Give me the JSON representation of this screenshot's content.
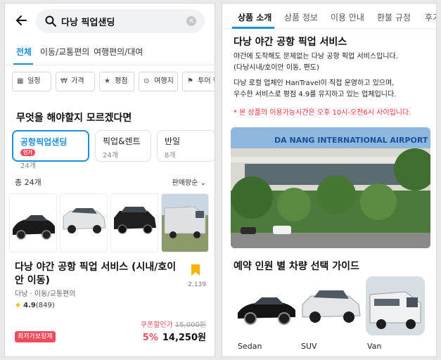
{
  "left": {
    "search": {
      "query": "다낭 픽업샌딩"
    },
    "tabs": [
      {
        "label": "전체"
      },
      {
        "label": "이동/교통편의"
      },
      {
        "label": "여행편의/대여"
      }
    ],
    "filters": [
      {
        "icon": "calendar-icon",
        "label": "일정"
      },
      {
        "icon": "won-icon",
        "label": "가격"
      },
      {
        "icon": "star-icon",
        "label": "평점"
      },
      {
        "icon": "location-pin-icon",
        "label": "여행지"
      },
      {
        "icon": "flag-icon",
        "label": "투어 형태"
      }
    ],
    "section_question": "무엇을 해야할지 모르겠다면",
    "categories": [
      {
        "name": "공항픽업샌딩",
        "badge": "인기",
        "count": "24개"
      },
      {
        "name": "픽업&렌트",
        "count": "24개"
      },
      {
        "name": "반일",
        "count": "8개"
      }
    ],
    "total": "총 24개",
    "sort": "판매량순",
    "product": {
      "title": "다낭 야간 공항 픽업 서비스 (시내/호이안 이동)",
      "category": "다낭 · 이동/교통편의",
      "rating": "4.9",
      "reviews": "(849)",
      "bookmarks": "2,139",
      "coupon_label": "쿠폰할인가",
      "original_price": "15,000원",
      "tag": "최저가보장제",
      "discount": "5%",
      "price": "14,250원"
    },
    "colors": {
      "accent": "#1b8fe0",
      "sale": "#ef4b5c",
      "bookmark": "#f5b400"
    }
  },
  "right": {
    "tabs": [
      {
        "label": "상품 소개"
      },
      {
        "label": "상품 정보"
      },
      {
        "label": "이용 안내"
      },
      {
        "label": "환불 규정"
      },
      {
        "label": "후기"
      }
    ],
    "heading": "다낭 야간 공항 픽업 서비스",
    "para1_line1": "야간에 도착해도 문제없는 다낭 공항 픽업 서비스입니다.",
    "para1_line2": "(다낭시내/호이안 이동, 편도)",
    "para2_line1": "다낭 로컬 업체인 HanTravel이 직접 운영하고 있으며,",
    "para2_line2": "우수한 서비스로 평점 4.9를 유지하고 있는 업체입니다.",
    "warning": "* 본 상품의 이용가능시간은 오후 10시-오전6시 사이입니다.",
    "airport_sign": "DA NANG INTERNATIONAL AIRPORT",
    "guide_heading": "예약 인원 별 차량 선택 가이드",
    "vehicles": [
      {
        "label": "Sedan"
      },
      {
        "label": "SUV"
      },
      {
        "label": "Van"
      }
    ]
  }
}
